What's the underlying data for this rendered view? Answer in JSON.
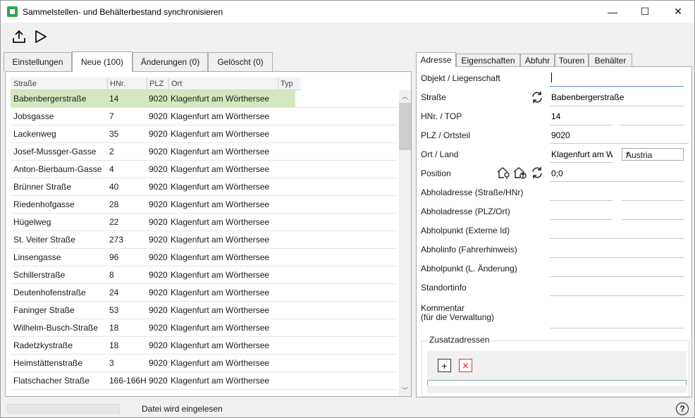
{
  "window": {
    "title": "Sammelstellen- und Behälterbestand synchronisieren",
    "minimize_glyph": "—",
    "maximize_glyph": "☐",
    "close_glyph": "✕"
  },
  "toolbar": {
    "buttons": [
      {
        "icon": "upload-icon"
      },
      {
        "icon": "play-icon"
      }
    ]
  },
  "left_tabs": [
    {
      "label": "Einstellungen"
    },
    {
      "label": "Neue (100)",
      "active": true
    },
    {
      "label": "Änderungen (0)"
    },
    {
      "label": "Gelöscht (0)"
    }
  ],
  "grid": {
    "columns": [
      "Straße",
      "HNr.",
      "PLZ",
      "Ort",
      "Typ"
    ],
    "rows": [
      {
        "strasse": "Babenbergerstraße",
        "hnr": "14",
        "plz": "9020",
        "ort": "Klagenfurt am Wörthersee",
        "selected": true
      },
      {
        "strasse": "Jobsgasse",
        "hnr": "7",
        "plz": "9020",
        "ort": "Klagenfurt am Wörthersee"
      },
      {
        "strasse": "Lackenweg",
        "hnr": "35",
        "plz": "9020",
        "ort": "Klagenfurt am Wörthersee"
      },
      {
        "strasse": "Josef-Mussger-Gasse",
        "hnr": "2",
        "plz": "9020",
        "ort": "Klagenfurt am Wörthersee"
      },
      {
        "strasse": "Anton-Bierbaum-Gasse",
        "hnr": "4",
        "plz": "9020",
        "ort": "Klagenfurt am Wörthersee"
      },
      {
        "strasse": "Brünner Straße",
        "hnr": "40",
        "plz": "9020",
        "ort": "Klagenfurt am Wörthersee"
      },
      {
        "strasse": "Riedenhofgasse",
        "hnr": "28",
        "plz": "9020",
        "ort": "Klagenfurt am Wörthersee"
      },
      {
        "strasse": "Hügelweg",
        "hnr": "22",
        "plz": "9020",
        "ort": "Klagenfurt am Wörthersee"
      },
      {
        "strasse": "St. Veiter Straße",
        "hnr": "273",
        "plz": "9020",
        "ort": "Klagenfurt am Wörthersee"
      },
      {
        "strasse": "Linsengasse",
        "hnr": "96",
        "plz": "9020",
        "ort": "Klagenfurt am Wörthersee"
      },
      {
        "strasse": "Schillerstraße",
        "hnr": "8",
        "plz": "9020",
        "ort": "Klagenfurt am Wörthersee"
      },
      {
        "strasse": "Deutenhofenstraße",
        "hnr": "24",
        "plz": "9020",
        "ort": "Klagenfurt am Wörthersee"
      },
      {
        "strasse": "Faninger Straße",
        "hnr": "53",
        "plz": "9020",
        "ort": "Klagenfurt am Wörthersee"
      },
      {
        "strasse": "Wilhelm-Busch-Straße",
        "hnr": "18",
        "plz": "9020",
        "ort": "Klagenfurt am Wörthersee"
      },
      {
        "strasse": "Radetzkystraße",
        "hnr": "18",
        "plz": "9020",
        "ort": "Klagenfurt am Wörthersee"
      },
      {
        "strasse": "Heimstättenstraße",
        "hnr": "3",
        "plz": "9020",
        "ort": "Klagenfurt am Wörthersee"
      },
      {
        "strasse": "Flatschacher Straße",
        "hnr": "166-166H",
        "plz": "9020",
        "ort": "Klagenfurt am Wörthersee"
      }
    ]
  },
  "right_tabs": [
    {
      "label": "Adresse",
      "active": true
    },
    {
      "label": "Eigenschaften"
    },
    {
      "label": "Abfuhr"
    },
    {
      "label": "Touren"
    },
    {
      "label": "Behälter"
    }
  ],
  "form": {
    "objekt_label": "Objekt / Liegenschaft",
    "objekt_value": "",
    "strasse_label": "Straße",
    "strasse_value": "Babenbergerstraße",
    "hnr_label": "HNr. / TOP",
    "hnr_value": "14",
    "top_value": "",
    "plz_label": "PLZ / Ortsteil",
    "plz_value": "9020",
    "ortsteil_value": "",
    "ort_label": "Ort / Land",
    "ort_value": "Klagenfurt am W",
    "land_value": "Austria",
    "position_label": "Position",
    "position_value": "0;0",
    "abholadresse_str_label": "Abholadresse (Straße/HNr)",
    "abholadresse_plz_label": "Abholadresse (PLZ/Ort)",
    "abholpunkt_ext_label": "Abholpunkt (Externe Id)",
    "abholinfo_label": "Abholinfo (Fahrerhinweis)",
    "abholpunkt_aend_label": "Abholpunkt (L. Änderung)",
    "standortinfo_label": "Standortinfo",
    "kommentar_label_1": "Kommentar",
    "kommentar_label_2": "(für die Verwaltung)",
    "zusatz_title": "Zusatzadressen"
  },
  "status": {
    "text": "Datei wird eingelesen",
    "progress": 0,
    "help_glyph": "?"
  }
}
